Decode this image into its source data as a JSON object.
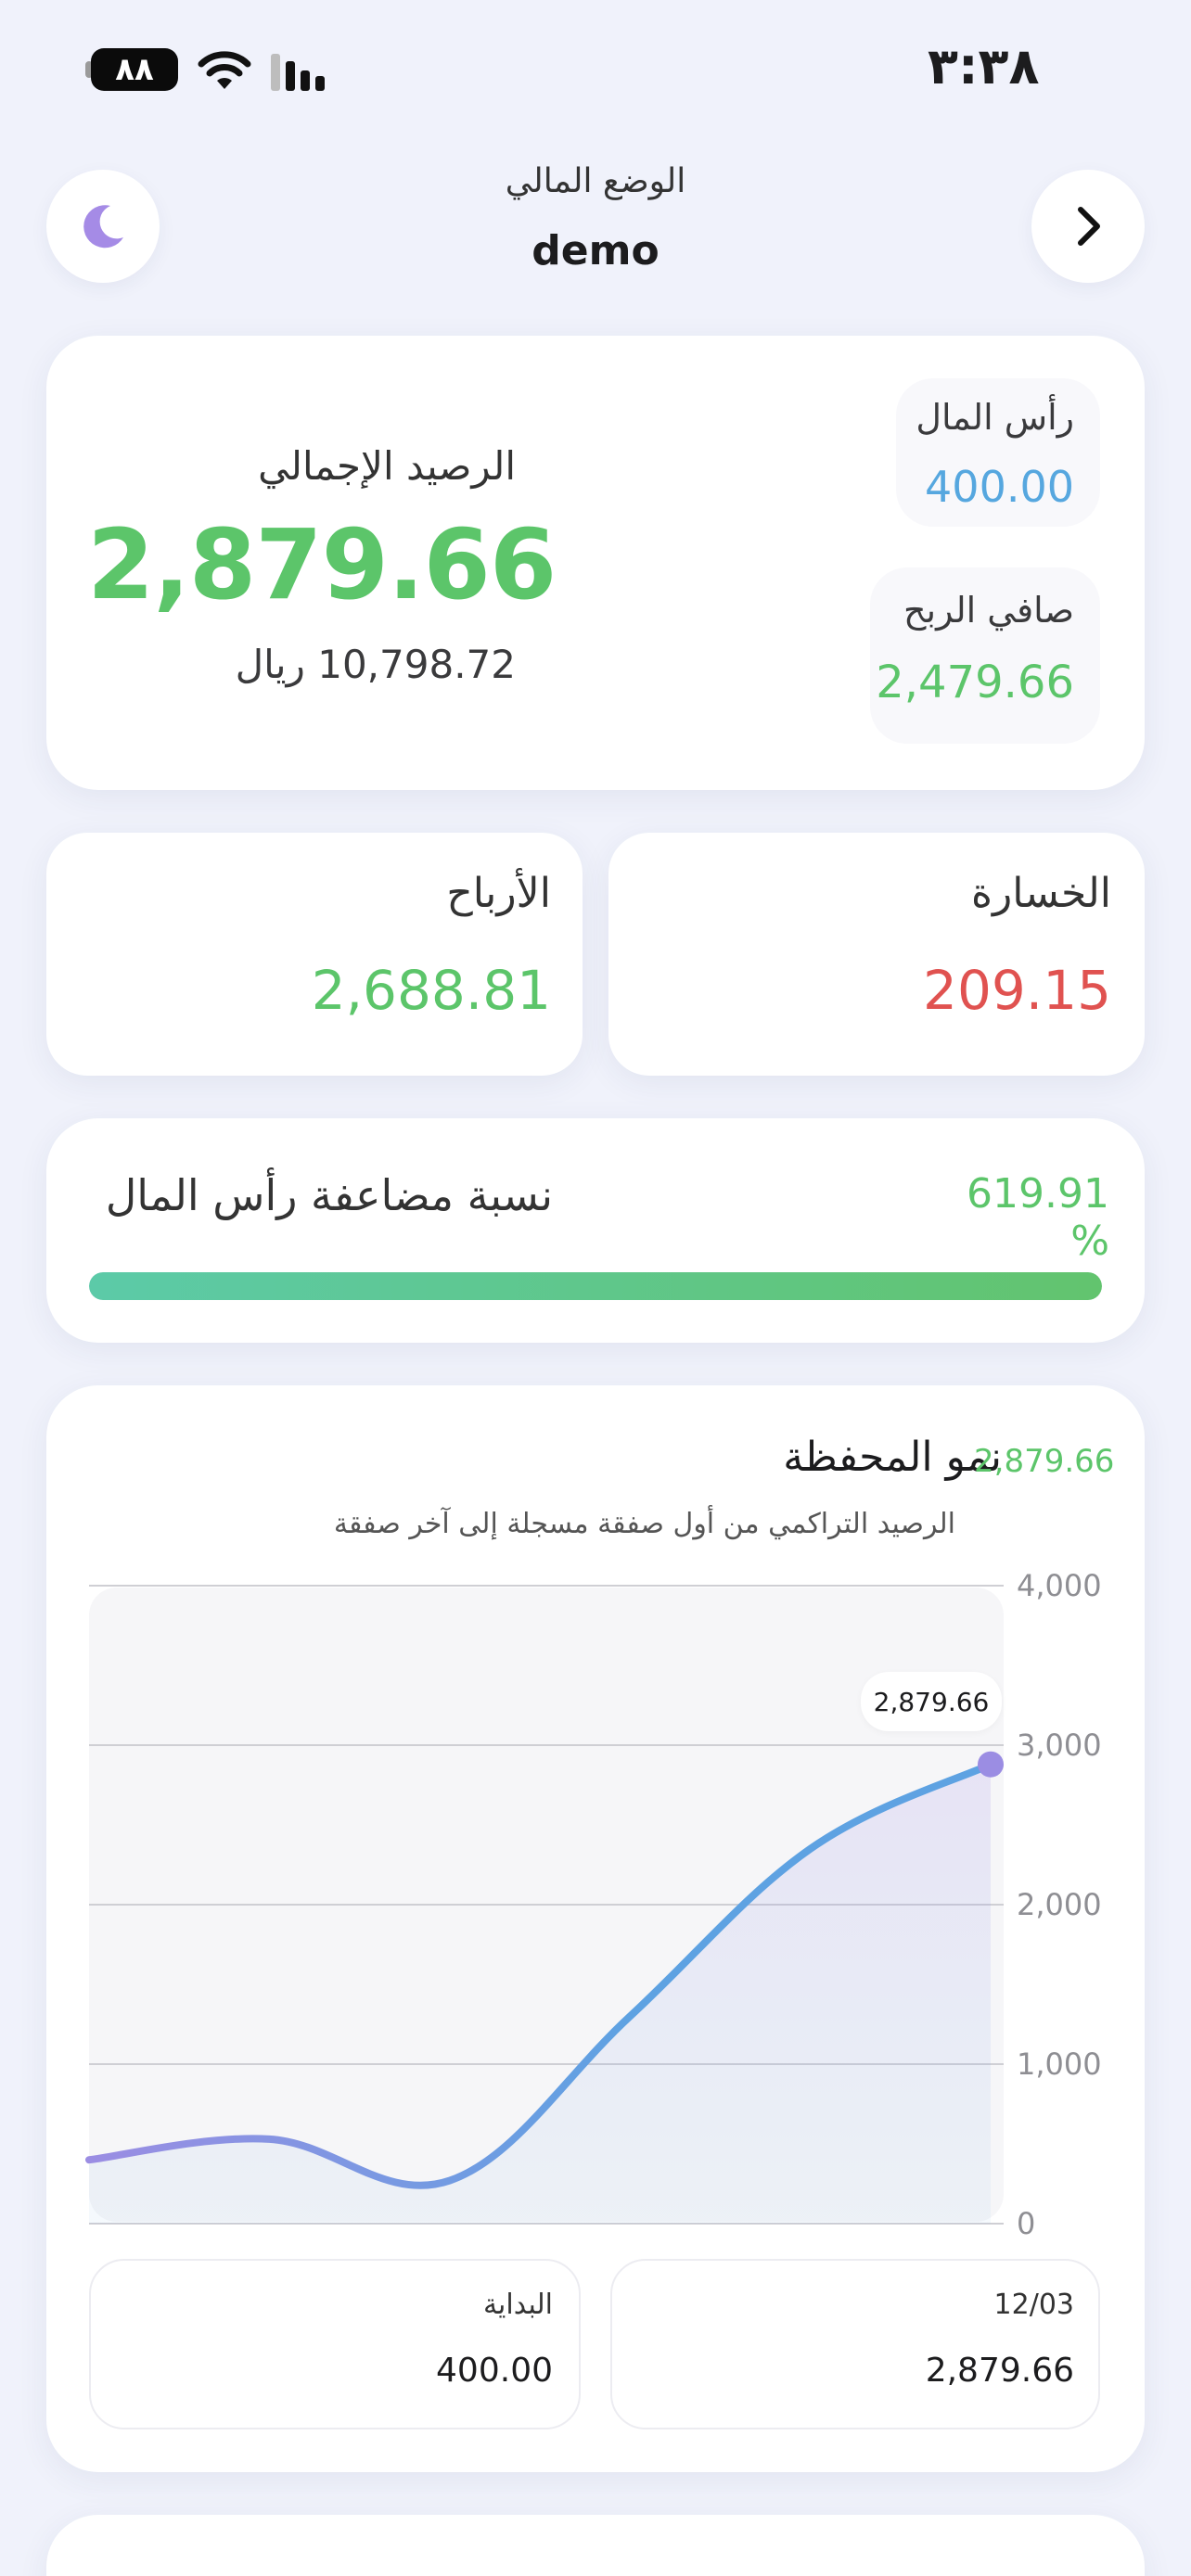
{
  "status_bar": {
    "time": "٣:٣٨",
    "battery": "٨٨"
  },
  "header": {
    "subtitle": "الوضع المالي",
    "title": "demo"
  },
  "balance": {
    "title": "الرصيد الإجمالي",
    "amount": "2,879.66",
    "local_amount": "10,798.72 ريال",
    "capital_label": "رأس المال",
    "capital_value": "400.00",
    "net_profit_label": "صافي الربح",
    "net_profit_value": "2,479.66"
  },
  "profits": {
    "label": "الأرباح",
    "value": "2,688.81"
  },
  "loss": {
    "label": "الخسارة",
    "value": "209.15"
  },
  "multiplier": {
    "label": "نسبة مضاعفة رأس المال",
    "value": "619.91 %",
    "progress": 1.0
  },
  "chart_data": {
    "type": "area",
    "title": "نمو المحفظة",
    "subtitle": "الرصيد التراكمي من أول صفقة مسجلة إلى آخر صفقة",
    "title_value": "2,879.66",
    "x": [
      0,
      1,
      2,
      3,
      4,
      5
    ],
    "y": [
      400,
      530,
      270,
      1300,
      2350,
      2879.66
    ],
    "ylim": [
      0,
      4000
    ],
    "y_ticks": [
      "4,000",
      "3,000",
      "2,000",
      "1,000",
      "0"
    ],
    "grid": true,
    "last_point_label": "2,879.66",
    "colors": {
      "line_start": "#9b8de3",
      "line_end": "#5ea2e2",
      "point": "#9b8de3"
    }
  },
  "chart_stats": {
    "start_label": "البداية",
    "start_value": "400.00",
    "end_label": "12/03",
    "end_value": "2,879.66"
  },
  "icons": {
    "theme": "moon-icon",
    "nav": "chevron-right-icon"
  }
}
